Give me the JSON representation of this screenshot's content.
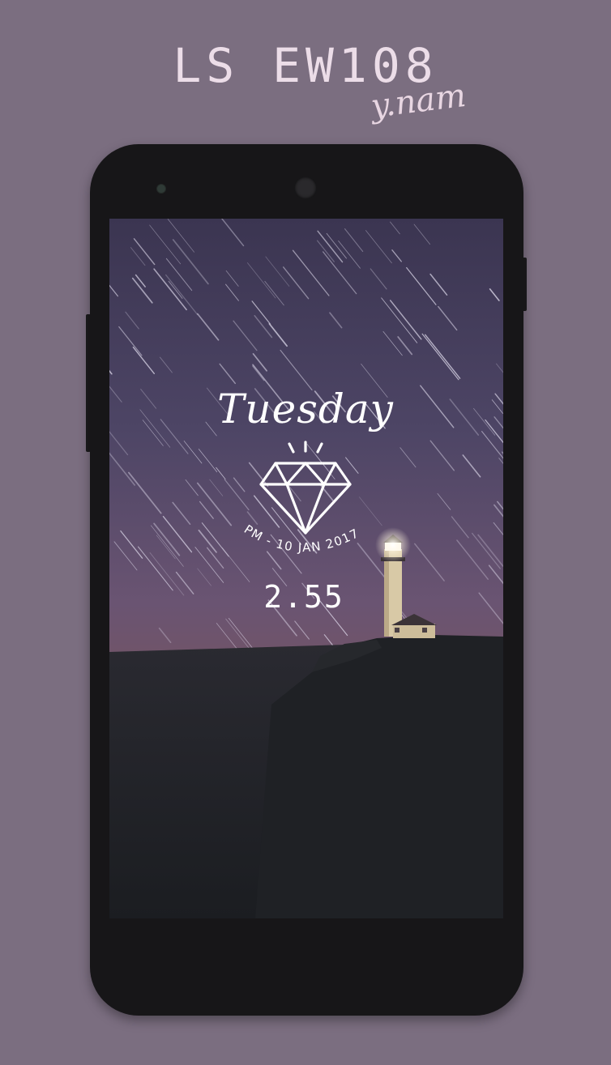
{
  "header": {
    "title": "LS EW108",
    "author": "y.nam"
  },
  "lockscreen": {
    "day": "Tuesday",
    "date_line": "PM - 10 JAN 2017",
    "time": "2.55"
  },
  "colors": {
    "background": "#7b6e80",
    "phone_body": "#171618",
    "title_text": "#ecdde8",
    "widget_text": "#ffffff"
  }
}
